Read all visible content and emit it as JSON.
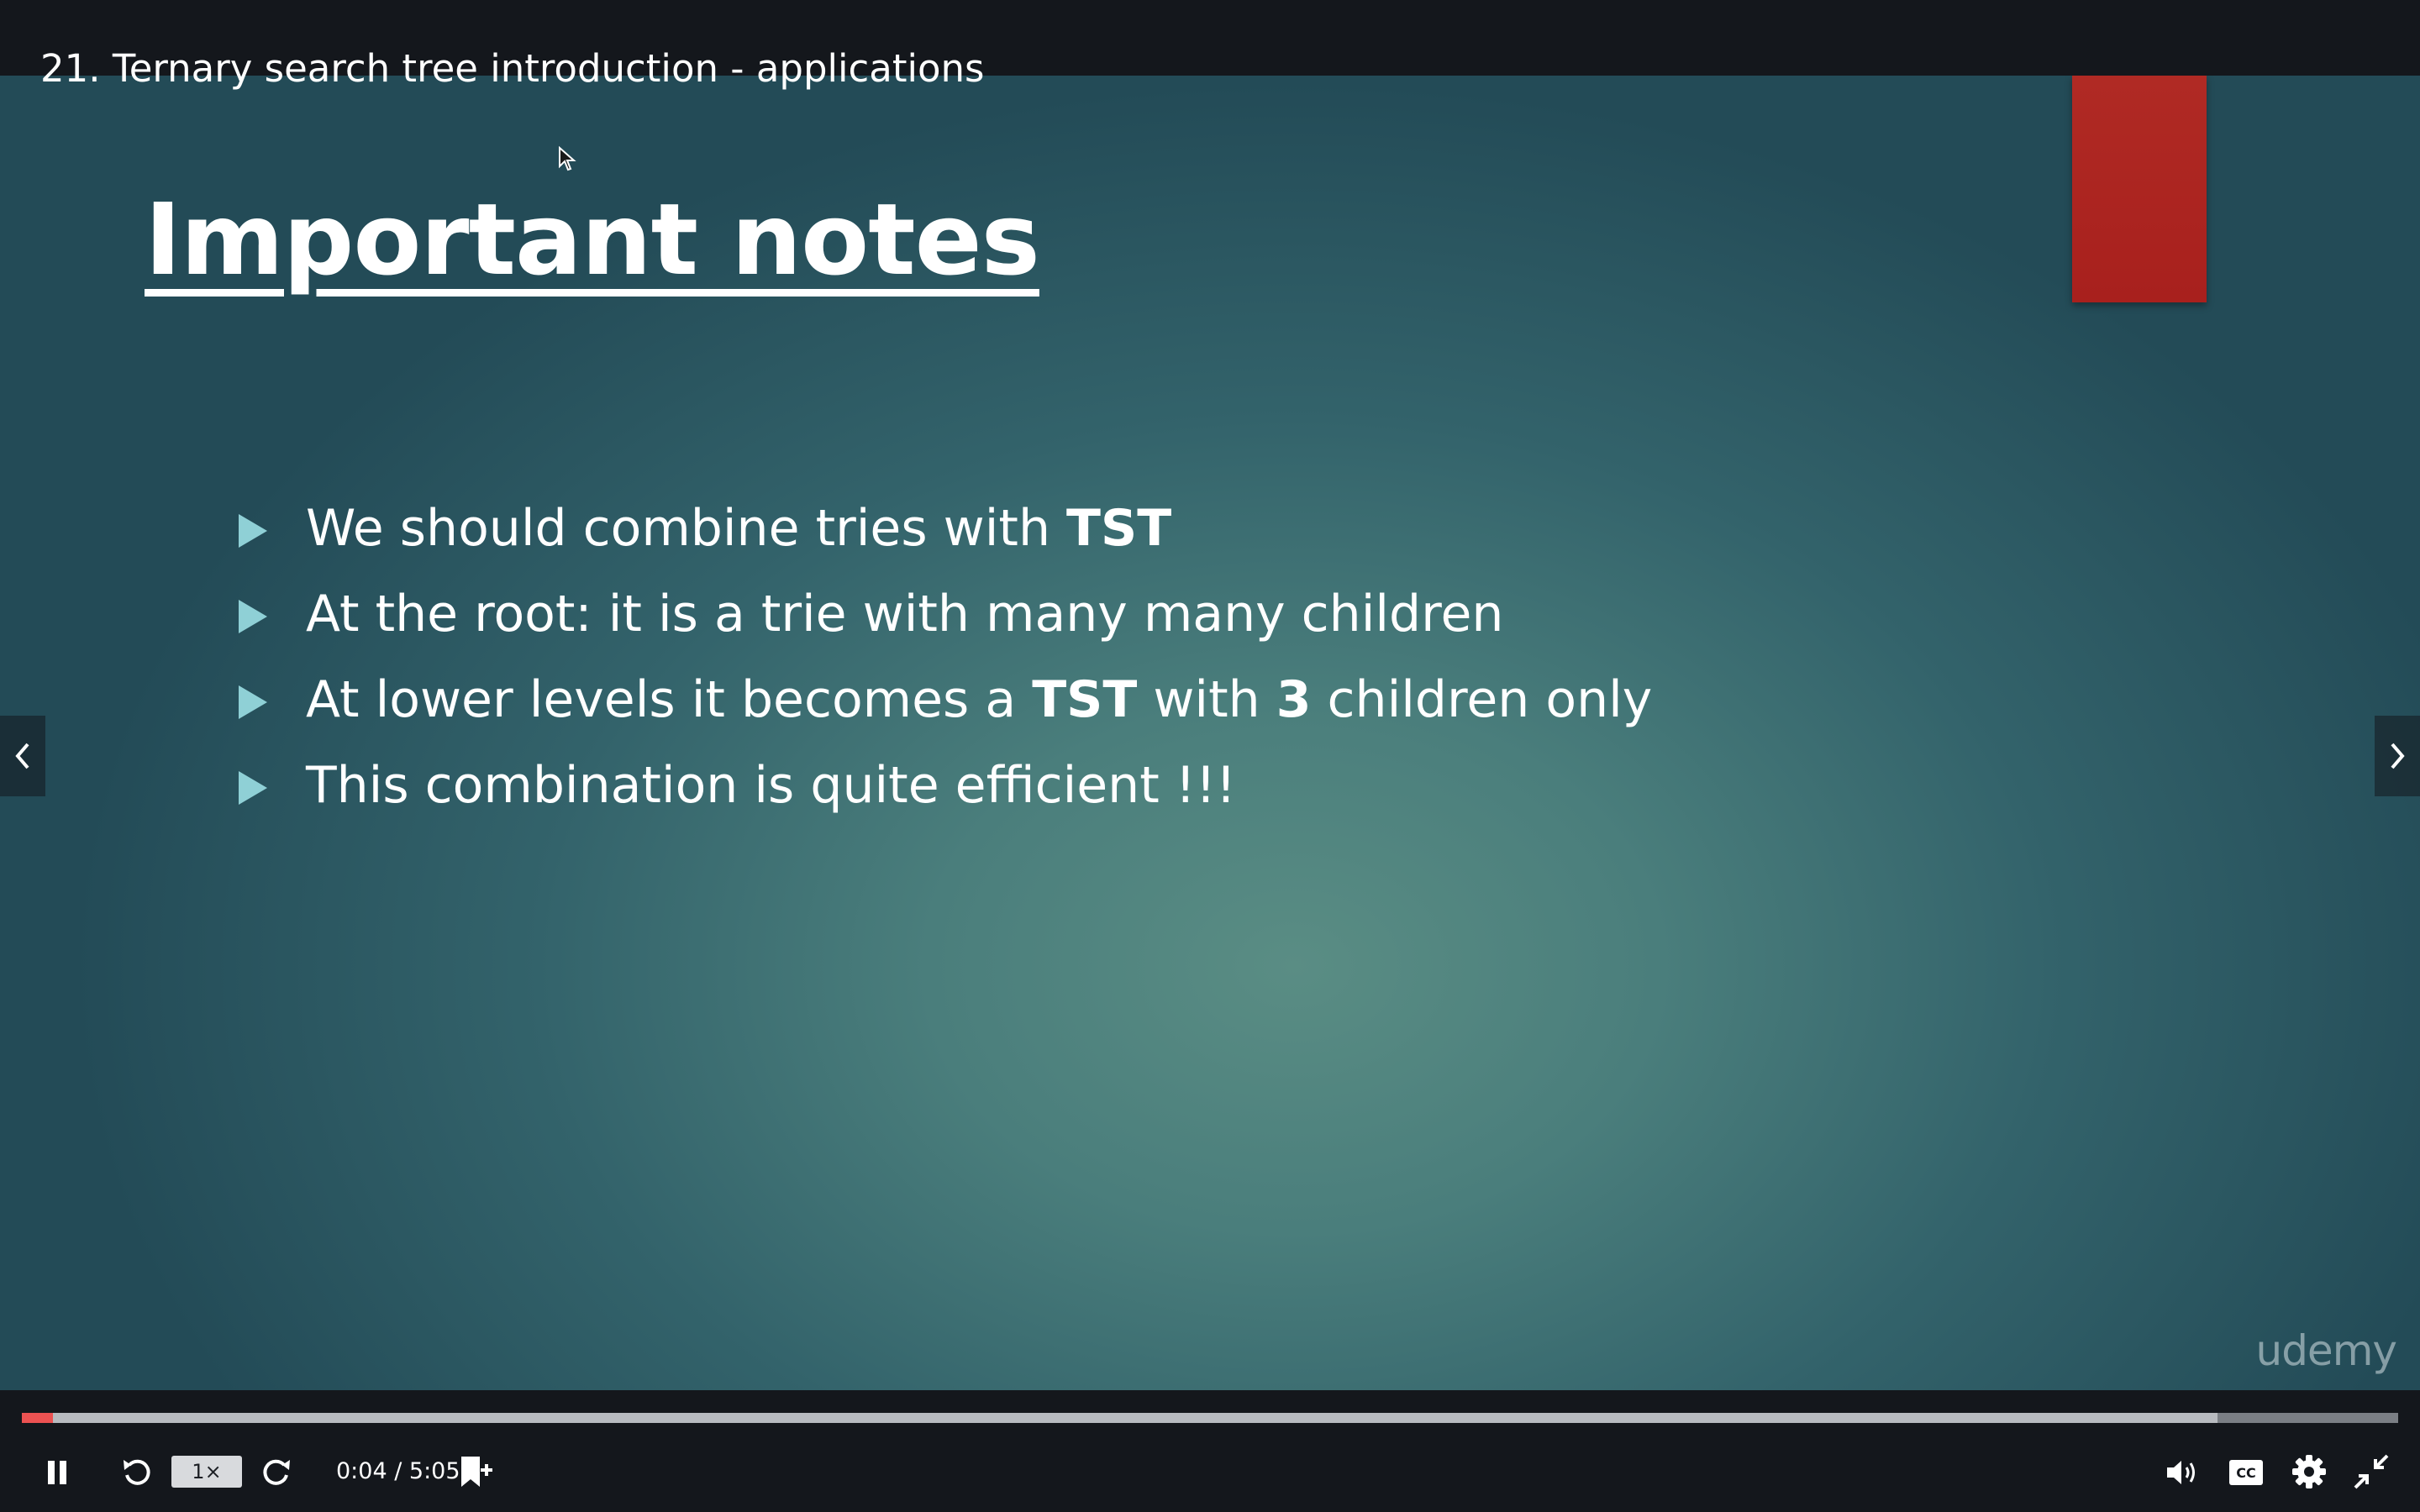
{
  "lecture": {
    "title": "21. Ternary search tree introduction - applications"
  },
  "slide": {
    "heading": "Important notes",
    "bullets": [
      {
        "parts": [
          {
            "text": "We should combine tries with ",
            "bold": false
          },
          {
            "text": "TST",
            "bold": true
          }
        ]
      },
      {
        "parts": [
          {
            "text": "At the root: it is a trie with many many children",
            "bold": false
          }
        ]
      },
      {
        "parts": [
          {
            "text": "At lower levels it becomes a ",
            "bold": false
          },
          {
            "text": "TST",
            "bold": true
          },
          {
            "text": " with ",
            "bold": false
          },
          {
            "text": "3",
            "bold": true
          },
          {
            "text": " children only",
            "bold": false
          }
        ]
      },
      {
        "parts": [
          {
            "text": "This combination is quite efficient !!!",
            "bold": false
          }
        ]
      }
    ],
    "watermark": "udemy",
    "accent_color": "#a8201d"
  },
  "player": {
    "current_time": "0:04",
    "duration": "5:05",
    "time_text": "0:04 / 5:05",
    "progress_fraction": 0.0131,
    "buffered_fraction": 0.924,
    "speed_label": "1×",
    "progress_color": "#ec5252",
    "icons": {
      "pause": "pause-icon",
      "rewind": "rewind-icon",
      "forward": "forward-icon",
      "bookmark": "add-bookmark-icon",
      "volume": "volume-icon",
      "captions": "captions-icon",
      "settings": "gear-icon",
      "fullscreen": "exit-fullscreen-icon",
      "prev": "chevron-left-icon",
      "next": "chevron-right-icon"
    }
  }
}
